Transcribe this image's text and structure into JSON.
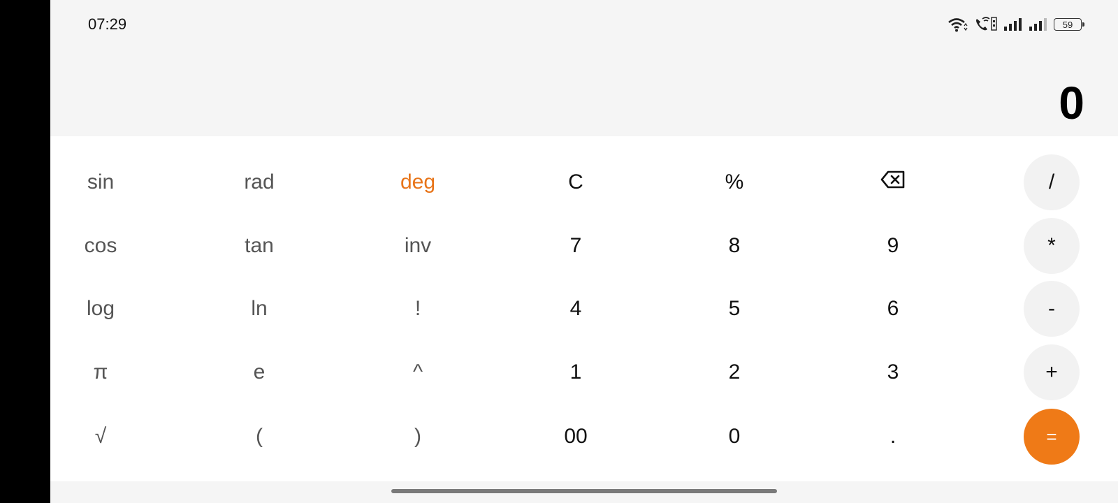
{
  "status_bar": {
    "time": "07:29",
    "battery": "59",
    "icons": [
      "wifi-icon",
      "wifi-calling-icon",
      "signal-icon",
      "signal-icon",
      "battery-icon"
    ]
  },
  "display": {
    "result": "0"
  },
  "keys": {
    "sin": "sin",
    "rad": "rad",
    "deg": "deg",
    "clear": "C",
    "percent": "%",
    "divide": "/",
    "cos": "cos",
    "tan": "tan",
    "inv": "inv",
    "seven": "7",
    "eight": "8",
    "nine": "9",
    "multiply": "*",
    "log": "log",
    "ln": "ln",
    "factorial": "!",
    "four": "4",
    "five": "5",
    "six": "6",
    "minus": "-",
    "pi": "π",
    "e": "e",
    "power": "^",
    "one": "1",
    "two": "2",
    "three": "3",
    "plus": "+",
    "sqrt": "√",
    "open_paren": "(",
    "close_paren": ")",
    "double_zero": "00",
    "zero": "0",
    "decimal": ".",
    "equals": "="
  },
  "colors": {
    "accent": "#e8751a",
    "equals_bg": "#ef7a17",
    "operator_bg": "#f2f2f2"
  }
}
